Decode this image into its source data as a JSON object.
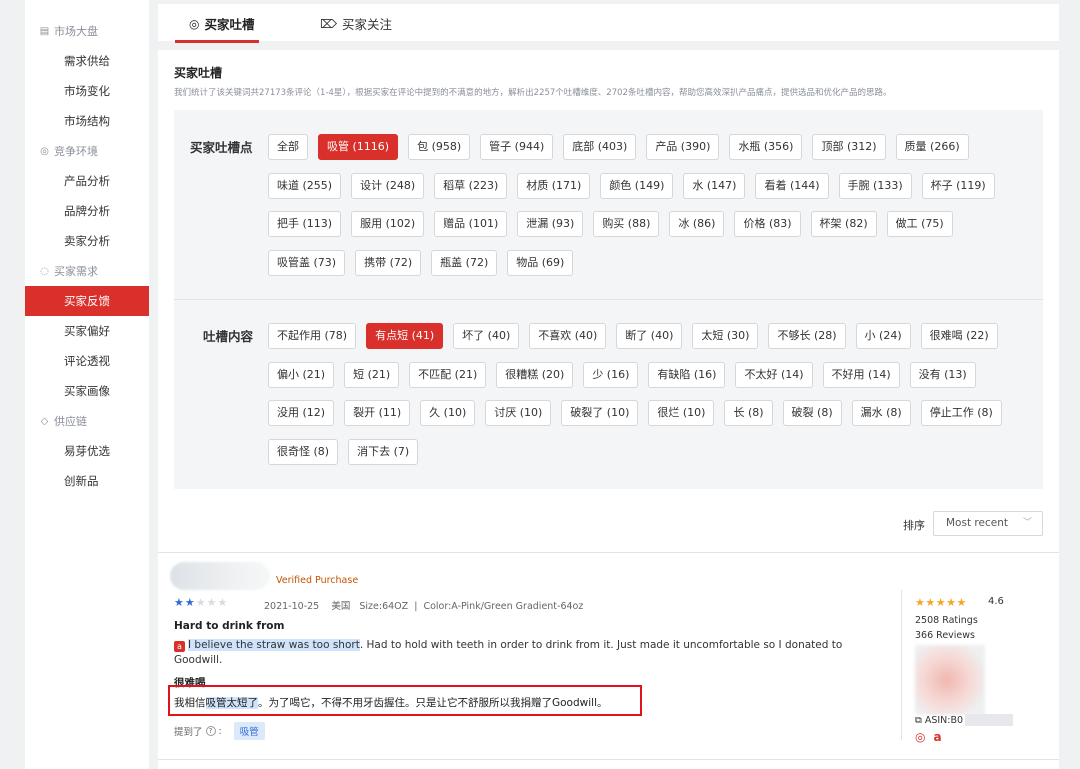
{
  "sidebar": {
    "groups": [
      {
        "label": "市场大盘",
        "icon": "chart-icon",
        "items": [
          "需求供给",
          "市场变化",
          "市场结构"
        ]
      },
      {
        "label": "竞争环境",
        "icon": "target-icon",
        "items": [
          "产品分析",
          "品牌分析",
          "卖家分析"
        ]
      },
      {
        "label": "买家需求",
        "icon": "chat-icon",
        "items": [
          "买家反馈",
          "买家偏好",
          "评论透视",
          "买家画像"
        ]
      },
      {
        "label": "供应链",
        "icon": "shield-icon",
        "items": [
          "易芽优选",
          "创新品"
        ]
      }
    ],
    "active_item": "买家反馈"
  },
  "tabs": [
    {
      "label": "买家吐槽",
      "icon": "target-icon",
      "active": true
    },
    {
      "label": "买家关注",
      "icon": "tag-icon",
      "active": false
    }
  ],
  "section": {
    "title": "买家吐槽",
    "description": "我们统计了该关键词共27173条评论（1-4星），根据买家在评论中提到的不满意的地方，解析出2257个吐槽维度、2702条吐槽内容，帮助您高效深扒产品痛点，提供选品和优化产品的思路。"
  },
  "complaint_points": {
    "label": "买家吐槽点",
    "tags": [
      "全部",
      "吸管 (1116)",
      "包 (958)",
      "管子 (944)",
      "底部 (403)",
      "产品 (390)",
      "水瓶 (356)",
      "顶部 (312)",
      "质量 (266)",
      "味道 (255)",
      "设计 (248)",
      "稻草 (223)",
      "材质 (171)",
      "颜色 (149)",
      "水 (147)",
      "看着 (144)",
      "手腕 (133)",
      "杯子 (119)",
      "把手 (113)",
      "服用 (102)",
      "赠品 (101)",
      "泄漏 (93)",
      "购买 (88)",
      "冰 (86)",
      "价格 (83)",
      "杯架 (82)",
      "做工 (75)",
      "吸管盖 (73)",
      "携带 (72)",
      "瓶盖 (72)",
      "物品 (69)"
    ],
    "active_index": 1
  },
  "complaint_content": {
    "label": "吐槽内容",
    "tags": [
      "不起作用 (78)",
      "有点短 (41)",
      "坏了 (40)",
      "不喜欢 (40)",
      "断了 (40)",
      "太短 (30)",
      "不够长 (28)",
      "小 (24)",
      "很难喝 (22)",
      "偏小 (21)",
      "短 (21)",
      "不匹配 (21)",
      "很糟糕 (20)",
      "少 (16)",
      "有缺陷 (16)",
      "不太好 (14)",
      "不好用 (14)",
      "没有 (13)",
      "没用 (12)",
      "裂开 (11)",
      "久 (10)",
      "讨厌 (10)",
      "破裂了 (10)",
      "很烂 (10)",
      "长 (8)",
      "破裂 (8)",
      "漏水 (8)",
      "停止工作 (8)",
      "很奇怪 (8)",
      "消下去 (7)"
    ],
    "active_index": 1
  },
  "sort": {
    "label": "排序",
    "value": "Most recent"
  },
  "review": {
    "verified": "Verified Purchase",
    "rating": 2,
    "max_rating": 5,
    "date": "2021-10-25",
    "country": "美国",
    "size": "Size:64OZ",
    "color": "Color:A-Pink/Green Gradient-64oz",
    "title": "Hard to drink from",
    "badge": "a",
    "en_highlight": "I believe the straw was too short",
    "en_rest": ". Had to hold with teeth in order to drink from it. Just made it uncomfortable so I donated to Goodwill.",
    "cn_title": "很难喝",
    "cn_pre": "我相信",
    "cn_highlight": "吸管太短了",
    "cn_rest": "。为了喝它，不得不用牙齿握住。只是让它不舒服所以我捐赠了Goodwill。",
    "mention_label": "提到了",
    "mention_tag": "吸管"
  },
  "product": {
    "rating": "4.6",
    "ratings": "2508 Ratings",
    "reviews": "366 Reviews",
    "asin_label": "ASIN:B0"
  }
}
